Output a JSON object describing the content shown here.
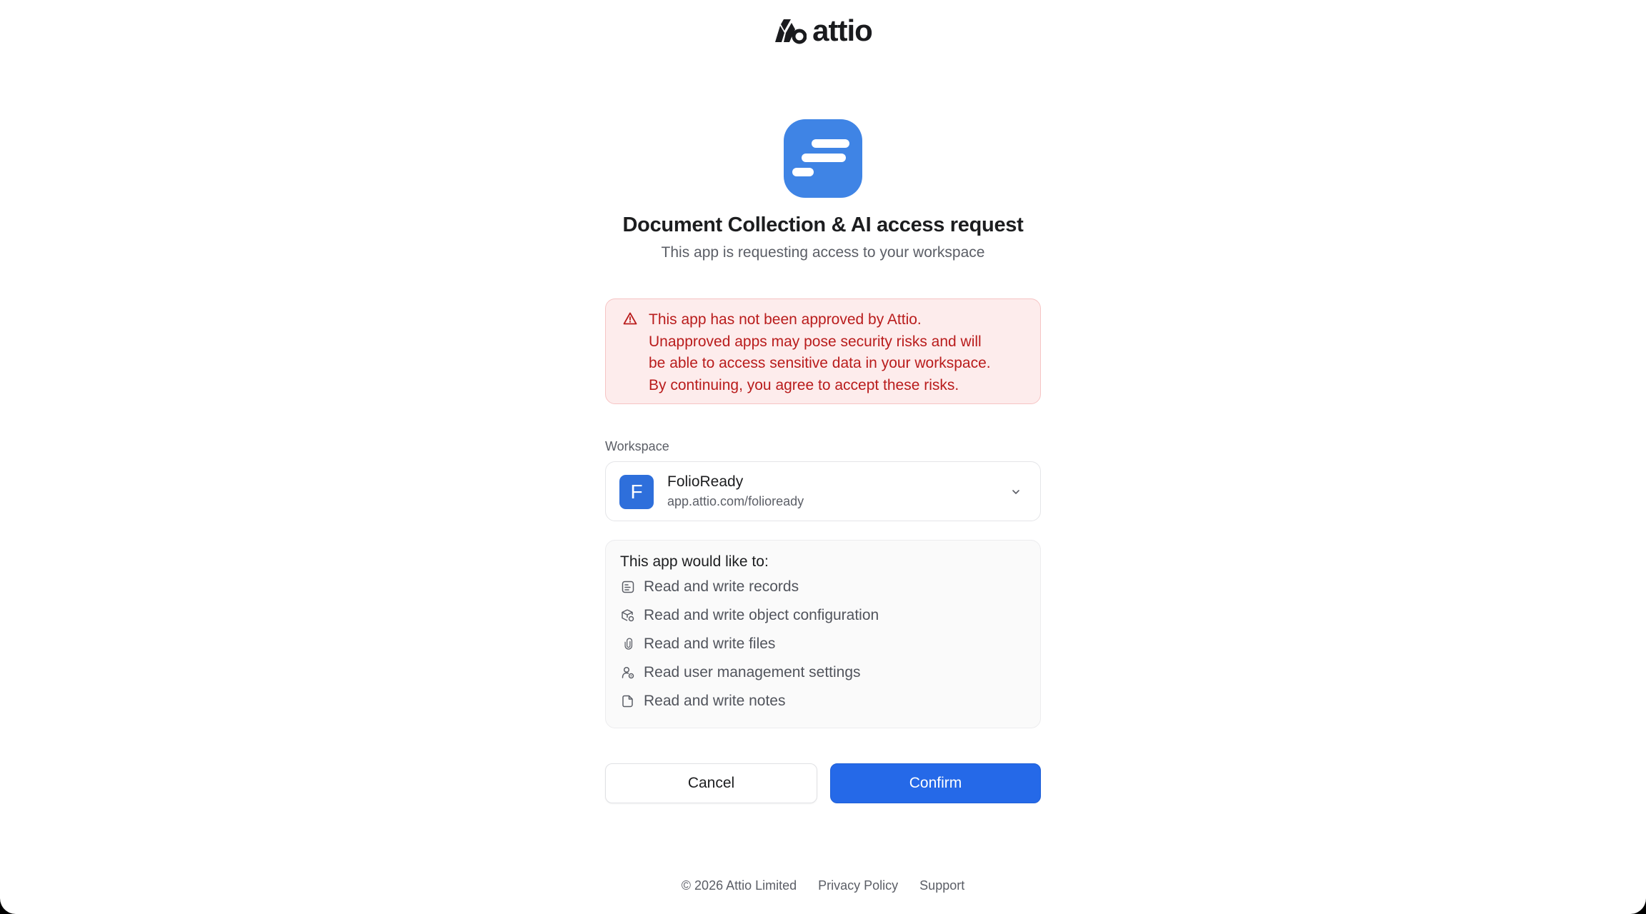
{
  "brand": {
    "name": "attio"
  },
  "app": {
    "icon": "text-lines-icon",
    "icon_color": "#3f84e5",
    "title": "Document Collection & AI access request",
    "subtitle": "This app is requesting access to your workspace"
  },
  "warning": {
    "icon": "warning-triangle-icon",
    "line1": "This app has not been approved by Attio.",
    "line2": "Unapproved apps may pose security risks and will",
    "line3": "be able to access sensitive data in your workspace.",
    "line4": "By continuing, you agree to accept these risks."
  },
  "workspace": {
    "label": "Workspace",
    "avatar_letter": "F",
    "name": "FolioReady",
    "url": "app.attio.com/folioready"
  },
  "permissions": {
    "heading": "This app would like to:",
    "items": [
      {
        "icon": "records-icon",
        "label": "Read and write records"
      },
      {
        "icon": "object-config-icon",
        "label": "Read and write object configuration"
      },
      {
        "icon": "paperclip-icon",
        "label": "Read and write files"
      },
      {
        "icon": "user-settings-icon",
        "label": "Read user management settings"
      },
      {
        "icon": "note-icon",
        "label": "Read and write notes"
      }
    ]
  },
  "actions": {
    "cancel_label": "Cancel",
    "confirm_label": "Confirm"
  },
  "footer": {
    "copyright": "© 2026 Attio Limited",
    "privacy": "Privacy Policy",
    "support": "Support"
  },
  "colors": {
    "accent": "#2569e8",
    "warning_bg": "#fdecec",
    "warning_text": "#b91c1c"
  }
}
